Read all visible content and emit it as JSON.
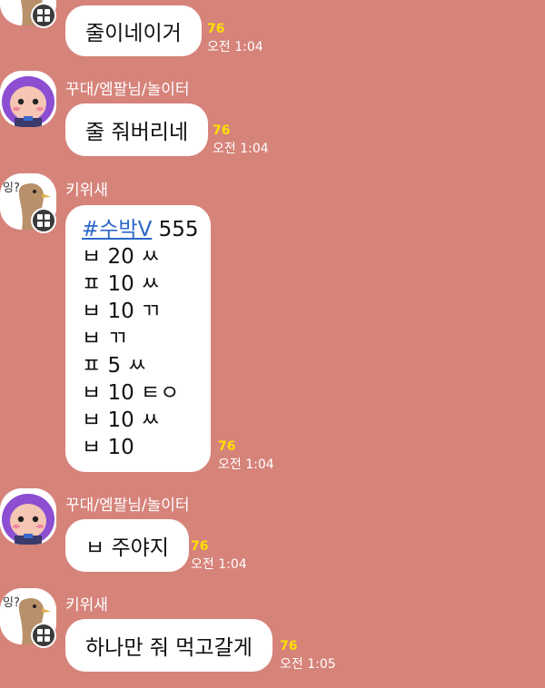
{
  "colors": {
    "background": "#d6837a",
    "bubble": "#ffffff",
    "unread": "#ffe100",
    "hashtag": "#2c68c9"
  },
  "messages": [
    {
      "sender": "",
      "avatar": "kiwi-bird-icon",
      "text": "줄이네이거",
      "unread": "76",
      "time": "오전 1:04"
    },
    {
      "sender": "꾸대/엠팔님/놀이터",
      "avatar": "purple-hair-girl-icon",
      "text": "줄 줘버리네",
      "unread": "76",
      "time": "오전 1:04"
    },
    {
      "sender": "키위새",
      "avatar": "kiwi-bird-icon",
      "hashtag": "#수박V",
      "hashtag_suffix": " 555",
      "lines": [
        "ㅂ 20 ㅆ",
        "ㅍ 10 ㅆ",
        "ㅂ 10 ㄲ",
        "ㅂ ㄲ",
        "ㅍ 5 ㅆ",
        "ㅂ 10 ㅌㅇ",
        "ㅂ 10 ㅆ",
        "ㅂ 10"
      ],
      "unread": "76",
      "time": "오전 1:04"
    },
    {
      "sender": "꾸대/엠팔님/놀이터",
      "avatar": "purple-hair-girl-icon",
      "text": "ㅂ 주야지",
      "unread": "76",
      "time": "오전 1:04"
    },
    {
      "sender": "키위새",
      "avatar": "kiwi-bird-icon",
      "text": "하나만 줘 먹고갈게",
      "unread": "76",
      "time": "오전 1:05"
    }
  ]
}
